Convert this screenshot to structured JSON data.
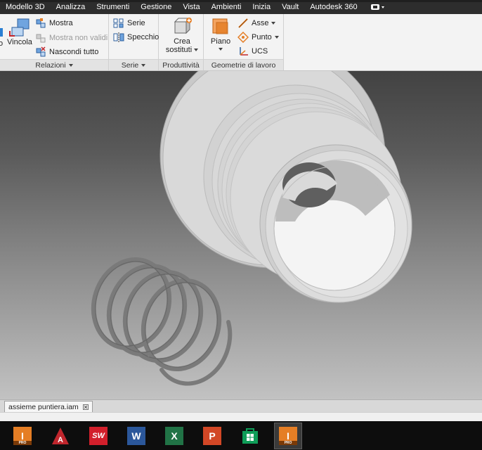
{
  "menu": {
    "items": [
      "Modello 3D",
      "Analizza",
      "Strumenti",
      "Gestione",
      "Vista",
      "Ambienti",
      "Inizia",
      "Vault",
      "Autodesk 360"
    ]
  },
  "ribbon": {
    "relazioni": {
      "vincola_label": "Vincola",
      "mostra_label": "Mostra",
      "mostra_non_validi_label": "Mostra non validi",
      "nascondi_tutto_label": "Nascondi tutto",
      "footer": "Relazioni",
      "cut_label": "o"
    },
    "serie": {
      "serie_label": "Serie",
      "specchio_label": "Specchio",
      "footer": "Serie"
    },
    "produttivita": {
      "crea_line1": "Crea",
      "crea_line2": "sostituti",
      "footer": "Produttività"
    },
    "geometrie": {
      "piano_label": "Piano",
      "asse_label": "Asse",
      "punto_label": "Punto",
      "ucs_label": "UCS",
      "footer": "Geometrie di lavoro"
    }
  },
  "document_tab": {
    "label": "assieme puntiera.iam"
  },
  "taskbar": {
    "apps": [
      "inventor-pro-icon",
      "autocad-icon",
      "solidworks-icon",
      "word-icon",
      "excel-icon",
      "powerpoint-icon",
      "windows-store-icon",
      "inventor-pro-active-icon"
    ],
    "inventor_badge": "PRO",
    "word_letter": "W",
    "excel_letter": "X",
    "powerpoint_letter": "P",
    "solidworks_letters": "SW",
    "autocad_letter": "A",
    "inventor_letter": "I"
  },
  "colors": {
    "menubar": "#2d2d2d",
    "ribbon": "#f3f3f3",
    "inventor_orange": "#e57e25",
    "autocad_red": "#c0262d",
    "word_blue": "#2b579a",
    "excel_green": "#217346",
    "powerpoint_orange": "#d24726",
    "store_green": "#0f9d58"
  }
}
